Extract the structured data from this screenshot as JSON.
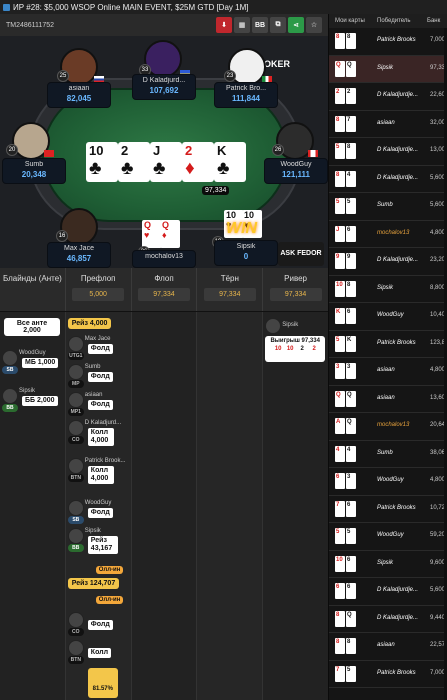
{
  "window": {
    "title": "ИР  #28: $5,000 WSOP Online MAIN EVENT, $25M GTD [Day 1M]"
  },
  "hand": {
    "id": "TM2486111752"
  },
  "toolbar": {
    "bb_label": "BB",
    "gg_label": "GGPOKER"
  },
  "board": [
    {
      "rank": "10",
      "suit": "♣",
      "color": "black"
    },
    {
      "rank": "2",
      "suit": "♣",
      "color": "black"
    },
    {
      "rank": "J",
      "suit": "♣",
      "color": "black"
    },
    {
      "rank": "2",
      "suit": "♦",
      "color": "red"
    },
    {
      "rank": "K",
      "suit": "♣",
      "color": "black"
    }
  ],
  "pot": {
    "total": "97,334"
  },
  "players": [
    {
      "name": "asiaan",
      "stack": "82,045",
      "level": "25"
    },
    {
      "name": "D Kaladjurd...",
      "stack": "107,692",
      "level": "33"
    },
    {
      "name": "Patrick Bro...",
      "stack": "111,844",
      "level": "23"
    },
    {
      "name": "Sumb",
      "stack": "20,348",
      "level": "20"
    },
    {
      "name": "WoodGuy",
      "stack": "121,111",
      "level": "26"
    },
    {
      "name": "Max Jace",
      "stack": "46,857",
      "level": "16"
    },
    {
      "name": "mochalov13",
      "stack": "81,540",
      "level": "26"
    },
    {
      "name": "Sipsik",
      "stack": "0",
      "level": "19"
    }
  ],
  "hero_cards": [
    {
      "rank": "Q",
      "suit": "♥"
    },
    {
      "rank": "Q",
      "suit": "♦"
    }
  ],
  "sipsik_cards": [
    {
      "rank": "10",
      "suit": "♥"
    },
    {
      "rank": "10",
      "suit": "♥"
    }
  ],
  "win_badge": "WIN",
  "streets": [
    {
      "label": "Блайнды (Анте)",
      "pot": ""
    },
    {
      "label": "Префлоп",
      "pot": "5,000"
    },
    {
      "label": "Флоп",
      "pot": "97,334"
    },
    {
      "label": "Тёрн",
      "pot": "97,334"
    },
    {
      "label": "Ривер",
      "pot": "97,334"
    }
  ],
  "blinds": {
    "ante_label": "Все анте",
    "ante_value": "2,000",
    "woodguy": "WoodGuy",
    "woodguy_pos": "SB",
    "woodguy_act": "МБ 1,000",
    "sipsik": "Sipsik",
    "sipsik_pos": "BB",
    "sipsik_act": "ББ 2,000"
  },
  "preflop": [
    {
      "chip": "Рейз 4,000"
    },
    {
      "name": "Max Jace",
      "pos": "UTG1",
      "act": "Фолд"
    },
    {
      "name": "Sumb",
      "pos": "MP",
      "act": "Фолд"
    },
    {
      "name": "asiaan",
      "pos": "MP1",
      "act": "Фолд"
    },
    {
      "name": "D Kaladjurd...",
      "pos": "CO",
      "act": "Колл 4,000"
    },
    {
      "name": "Patrick Brook...",
      "pos": "BTN",
      "act": "Колл 4,000"
    },
    {
      "name": "WoodGuy",
      "pos": "SB",
      "act": "Фолд"
    },
    {
      "name": "Sipsik",
      "pos": "BB",
      "act": "Рейз 43,167"
    },
    {
      "allin": "Олл-ин"
    },
    {
      "chip": "Рейз 124,707"
    },
    {
      "allin": "Олл-ин"
    },
    {
      "pos": "CO",
      "act": "Фолд"
    },
    {
      "pos": "BTN",
      "act": "Колл"
    },
    {
      "percent": "81.57%"
    }
  ],
  "river": {
    "name": "Sipsik",
    "win": "Выигрыш 97,334",
    "cards": [
      "10",
      "10",
      "2",
      "2"
    ]
  },
  "right": {
    "headers": [
      "Мои карты",
      "Победитель",
      "Банк"
    ],
    "rows": [
      {
        "cards": [
          "8",
          "8"
        ],
        "winner": "Patrick Brooks",
        "amt": "7,000"
      },
      {
        "cards": [
          "Q",
          "Q"
        ],
        "winner": "Sipsik",
        "amt": "97,33"
      },
      {
        "cards": [
          "2",
          "2"
        ],
        "winner": "D Kaladjurdje...",
        "amt": "22,60"
      },
      {
        "cards": [
          "8",
          "7"
        ],
        "winner": "asiaan",
        "amt": "32,00"
      },
      {
        "cards": [
          "5",
          "8"
        ],
        "winner": "D Kaladjurdje...",
        "amt": "13,00"
      },
      {
        "cards": [
          "8",
          "4"
        ],
        "winner": "D Kaladjurdje...",
        "amt": "5,600"
      },
      {
        "cards": [
          "5",
          "5"
        ],
        "winner": "Sumb",
        "amt": "5,600"
      },
      {
        "cards": [
          "J",
          "6"
        ],
        "winner": "mochalov13",
        "amt": "4,800"
      },
      {
        "cards": [
          "9",
          "9"
        ],
        "winner": "D Kaladjurdje...",
        "amt": "23,20"
      },
      {
        "cards": [
          "10",
          "8"
        ],
        "winner": "Sipsik",
        "amt": "8,800"
      },
      {
        "cards": [
          "K",
          "6"
        ],
        "winner": "WoodGuy",
        "amt": "10,40"
      },
      {
        "cards": [
          "5",
          "K"
        ],
        "winner": "Patrick Brooks",
        "amt": "123,8"
      },
      {
        "cards": [
          "3",
          "3"
        ],
        "winner": "asiaan",
        "amt": "4,800"
      },
      {
        "cards": [
          "Q",
          "Q"
        ],
        "winner": "asiaan",
        "amt": "13,60"
      },
      {
        "cards": [
          "A",
          "Q"
        ],
        "winner": "mochalov13",
        "amt": "20,64"
      },
      {
        "cards": [
          "4",
          "4"
        ],
        "winner": "Sumb",
        "amt": "38,06"
      },
      {
        "cards": [
          "6",
          "3"
        ],
        "winner": "WoodGuy",
        "amt": "4,800"
      },
      {
        "cards": [
          "7",
          "6"
        ],
        "winner": "Patrick Brooks",
        "amt": "10,72"
      },
      {
        "cards": [
          "5",
          "5"
        ],
        "winner": "WoodGuy",
        "amt": "59,20"
      },
      {
        "cards": [
          "10",
          "6"
        ],
        "winner": "Sipsik",
        "amt": "9,600"
      },
      {
        "cards": [
          "6",
          "6"
        ],
        "winner": "D Kaladjurdje...",
        "amt": "5,600"
      },
      {
        "cards": [
          "8",
          "Q"
        ],
        "winner": "D Kaladjurdje...",
        "amt": "9,440"
      },
      {
        "cards": [
          "8",
          "8"
        ],
        "winner": "asiaan",
        "amt": "22,57"
      },
      {
        "cards": [
          "7",
          "5"
        ],
        "winner": "Patrick Brooks",
        "amt": "7,000"
      }
    ]
  },
  "colors": {
    "felt": "#1f5f35",
    "accent": "#f3c64a",
    "stack": "#6ab8ff"
  }
}
